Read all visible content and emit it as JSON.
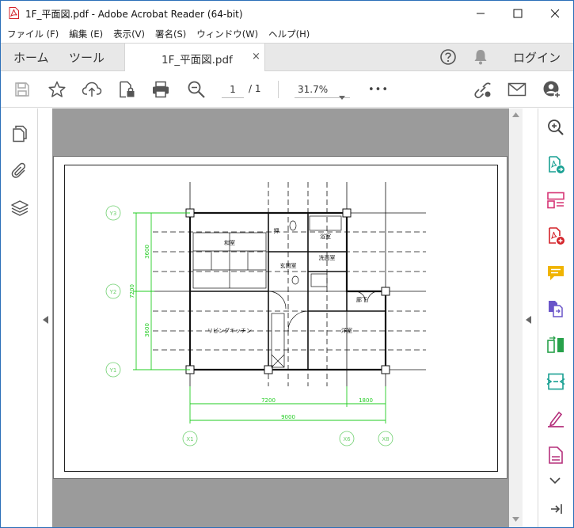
{
  "window": {
    "title": "1F_平面図.pdf - Adobe Acrobat Reader (64-bit)"
  },
  "menu": {
    "items": [
      "ファイル (F)",
      "編集 (E)",
      "表示(V)",
      "署名(S)",
      "ウィンドウ(W)",
      "ヘルプ(H)"
    ]
  },
  "tabs": {
    "home": "ホーム",
    "tools": "ツール",
    "document": "1F_平面図.pdf",
    "close": "×",
    "login": "ログイン"
  },
  "toolbar": {
    "page_current": "1",
    "page_total": "/ 1",
    "zoom": "31.7%",
    "more": "•••"
  },
  "plan": {
    "rooms": {
      "washitsu": "和室",
      "oshiire": "押",
      "bathroom": "浴室",
      "senmen": "洗面室",
      "genkan": "玄関室",
      "rouka": "廊下",
      "living": "リビングキッチン",
      "youshitsu": "洋室"
    },
    "dimensions": {
      "y_total": "7200",
      "y_upper": "3600",
      "y_lower": "3600",
      "x_left": "7200",
      "x_right": "1800",
      "x_total": "9000"
    },
    "grid_labels": {
      "y3": "Y3",
      "y2": "Y2",
      "y1": "Y1",
      "x1": "X1",
      "x6": "X6",
      "x8": "X8"
    }
  },
  "colors": {
    "pdf_red": "#d4232a",
    "acrobat_blue": "#2b6fb8",
    "dim_green": "#22cc22",
    "grid_green": "#6fd06f",
    "doc_bg": "#9b9b9b"
  }
}
